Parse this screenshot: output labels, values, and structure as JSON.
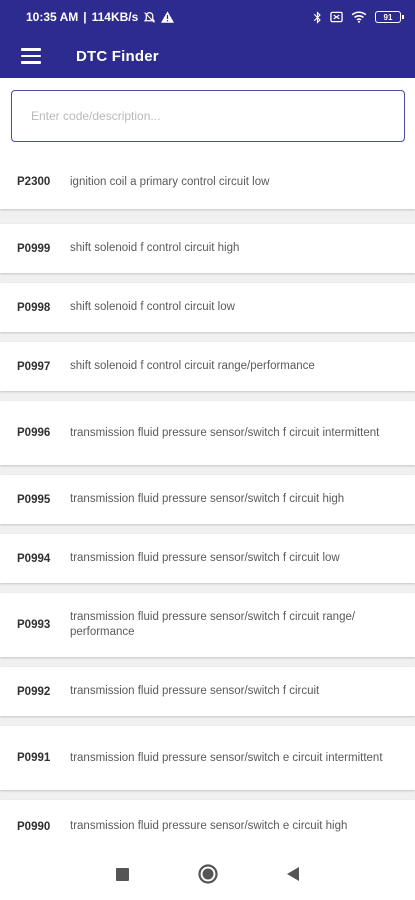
{
  "status_bar": {
    "time": "10:35 AM",
    "speed": "114KB/s",
    "battery": "91",
    "icons": [
      "bell-off-icon",
      "alert-triangle-icon",
      "bluetooth-icon",
      "sim-icon",
      "wifi-icon",
      "battery-icon"
    ]
  },
  "app_bar": {
    "title": "DTC Finder",
    "menu_icon": "hamburger-menu-icon",
    "color": "#2e2b8f"
  },
  "search": {
    "placeholder": "Enter code/description...",
    "value": ""
  },
  "codes": [
    {
      "code": "P2300",
      "description": "ignition coil a primary control circuit low"
    },
    {
      "code": "P0999",
      "description": "shift solenoid f control circuit high"
    },
    {
      "code": "P0998",
      "description": "shift solenoid f control circuit low"
    },
    {
      "code": "P0997",
      "description": "shift solenoid f control circuit range/performance"
    },
    {
      "code": "P0996",
      "description": "transmission fluid pressure sensor/switch f circuit intermittent"
    },
    {
      "code": "P0995",
      "description": "transmission fluid pressure sensor/switch f circuit high"
    },
    {
      "code": "P0994",
      "description": "transmission fluid pressure sensor/switch f circuit low"
    },
    {
      "code": "P0993",
      "description": "transmission fluid pressure sensor/switch f circuit range/ performance"
    },
    {
      "code": "P0992",
      "description": "transmission fluid pressure sensor/switch f circuit"
    },
    {
      "code": "P0991",
      "description": "transmission fluid pressure sensor/switch e circuit intermittent"
    },
    {
      "code": "P0990",
      "description": "transmission fluid pressure sensor/switch e circuit high"
    }
  ],
  "nav_bar": {
    "buttons": [
      "recents-square-icon",
      "home-circle-icon",
      "back-triangle-icon"
    ]
  }
}
